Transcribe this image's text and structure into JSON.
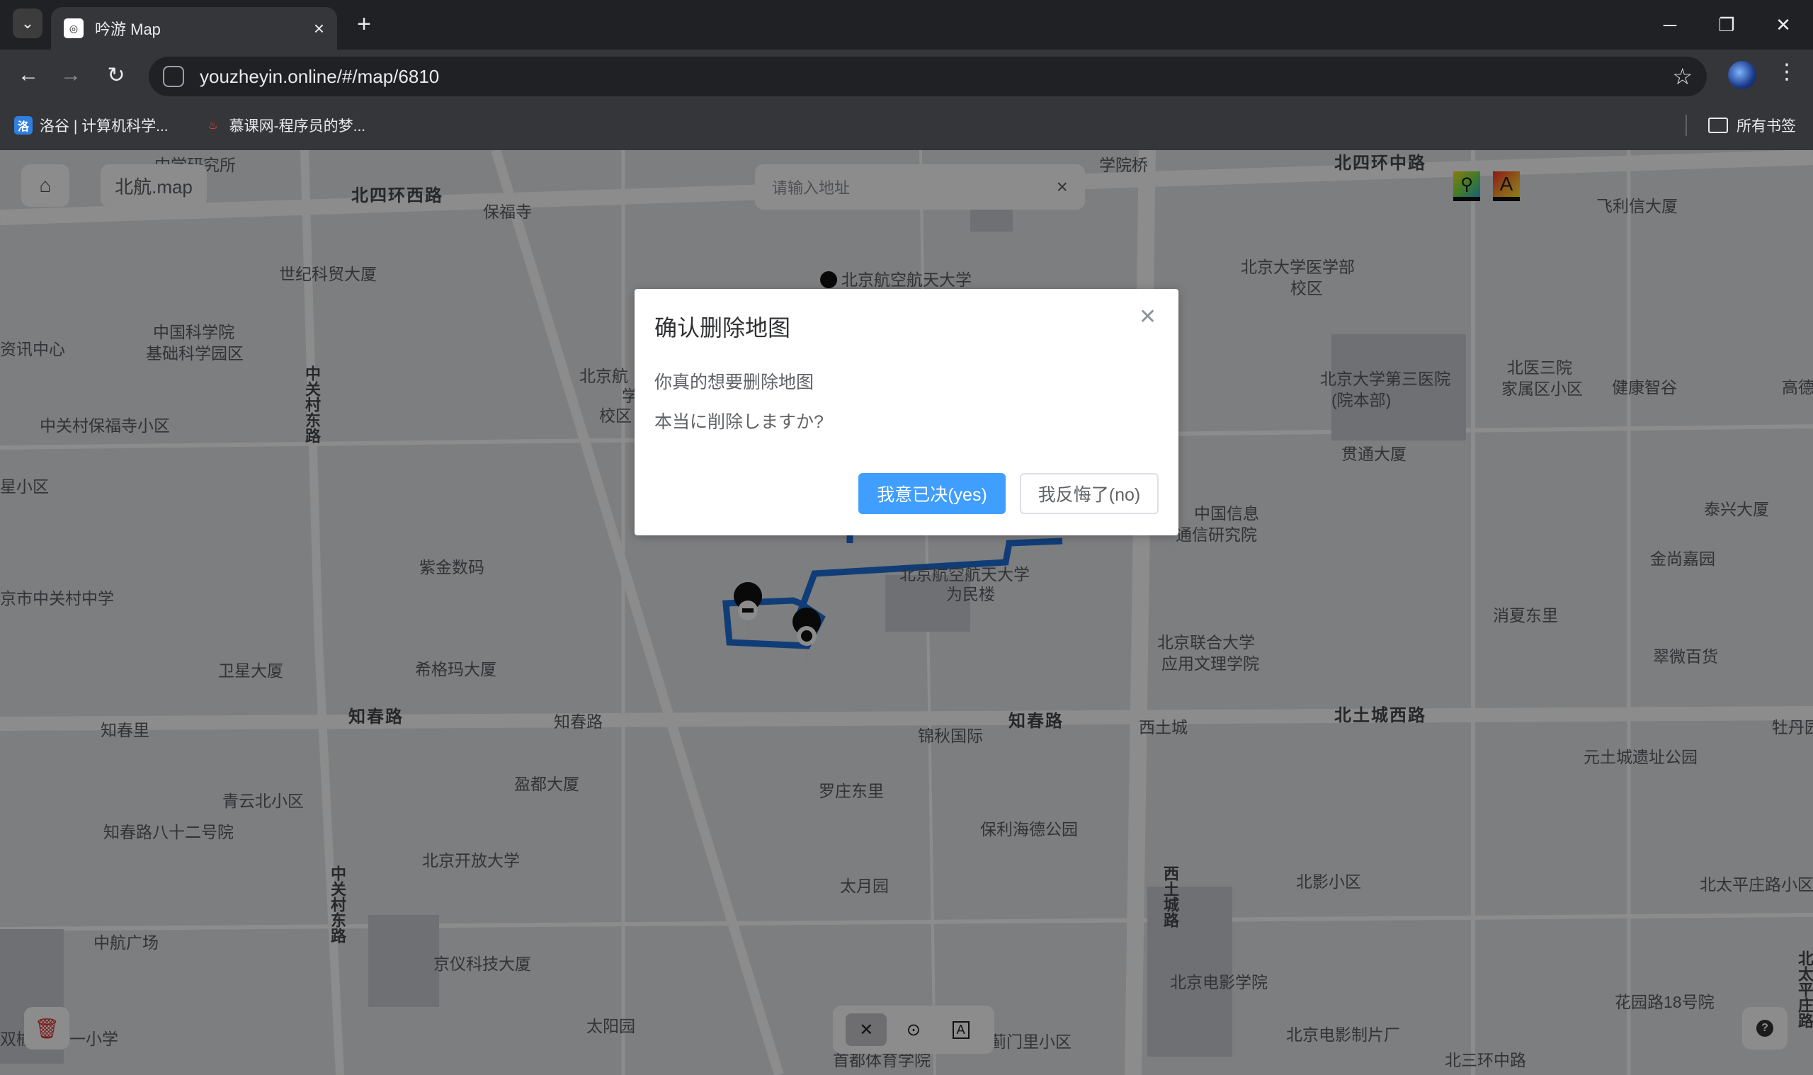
{
  "browser": {
    "tab_title": "吟游 Map",
    "url": "youzheyin.online/#/map/6810",
    "bookmarks": [
      {
        "label": "洛谷 | 计算机科学...",
        "icon": "luogu-icon"
      },
      {
        "label": "慕课网-程序员的梦...",
        "icon": "flame-icon"
      }
    ],
    "all_bookmarks": "所有书签"
  },
  "map": {
    "map_name": "北航.map",
    "search_placeholder": "请输入地址",
    "legend_a": "A",
    "labels": [
      "中学研究所",
      "学院桥",
      "北四环中路",
      "北四环西路",
      "保福寺",
      "飞利信大厦",
      "世纪科贸大厦",
      "北京航空航天大学",
      "北京大学医学部",
      "校区",
      "中国科学院",
      "基础科学园区",
      "资讯中心",
      "中关村保福寺小区",
      "北京航",
      "学",
      "校区",
      "北医三院",
      "家属区小区",
      "北京大学第三医院",
      "(院本部)",
      "健康智谷",
      "高德",
      "星小区",
      "贯通大厦",
      "中国信息",
      "通信研究院",
      "泰兴大厦",
      "紫金数码",
      "金尚嘉园",
      "京市中关村中学",
      "北京航空航天大学",
      "为民楼",
      "消夏东里",
      "北京联合大学",
      "应用文理学院",
      "卫星大厦",
      "希格玛大厦",
      "翠微百货",
      "知春里",
      "知春路",
      "知春路",
      "锦秋国际",
      "知春路",
      "西土城",
      "北土城西路",
      "牡丹园",
      "元土城遗址公园",
      "青云北小区",
      "盈都大厦",
      "罗庄东里",
      "知春路八十二号院",
      "保利海德公园",
      "北京开放大学",
      "太月园",
      "北影小区",
      "北太平庄路小区",
      "中航广场",
      "北京电影学院",
      "京仪科技大厦",
      "花园路18号院",
      "双榆",
      "一小学",
      "太阳园",
      "蓟门里小区",
      "北京电影制片厂",
      "首都体育学院",
      "北三环中路"
    ],
    "roads_vertical": [
      "中关村东路",
      "中关村东路",
      "西土城路",
      "北太平庄路"
    ]
  },
  "modal": {
    "title": "确认删除地图",
    "line1": "你真的想要删除地图",
    "line2": "本当に削除しますか?",
    "confirm_label": "我意已决(yes)",
    "cancel_label": "我反悔了(no)"
  },
  "colors": {
    "route": "#1e6fd9",
    "primary_button": "#409eff",
    "delete_icon": "#e03030"
  }
}
